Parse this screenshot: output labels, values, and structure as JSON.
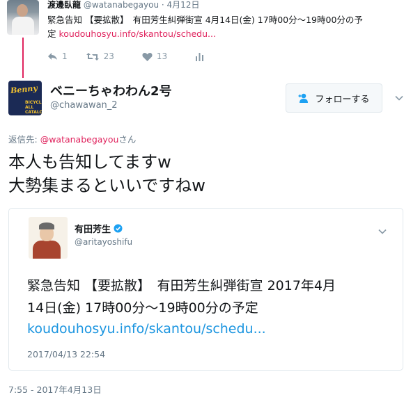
{
  "parent": {
    "name": "渡邊臥龍",
    "handle": "@watanabegayou",
    "dot": "·",
    "time": "4月12日",
    "text_line1": "緊急告知 【要拡散】　有田芳生糾弾街宣 4月14日(金) 17時00分〜19時00分の予",
    "text_line2": "定 ",
    "link": "koudouhosyu.info/skantou/schedu...",
    "actions": {
      "reply_count": "1",
      "retweet_count": "23",
      "like_count": "13"
    }
  },
  "tweet": {
    "display_name": "ベニーちゃわわん2号",
    "screen_name": "@chawawan_2",
    "follow_label": "フォローする",
    "avatar_logo": "Benny",
    "avatar_sub": "BICYCLE ALL CATALOG",
    "reply_prefix": "返信先: ",
    "reply_mention": "@watanabegayou",
    "reply_suffix": "さん",
    "text_line1": "本人も告知してますw",
    "text_line2": "大勢集まるといいですねw",
    "timestamp": "7:55 - 2017年4月13日"
  },
  "quote": {
    "name": "有田芳生",
    "handle": "@aritayoshifu",
    "text_line1": "緊急告知 【要拡散】　有田芳生糾弾街宣 2017年4月",
    "text_line2": "14日(金) 17時00分〜19時00分の予定",
    "link": "koudouhosyu.info/skantou/schedu...",
    "time": "2017/04/13 22:54"
  },
  "icons": [
    "reply-icon",
    "retweet-icon",
    "like-icon",
    "analytics-icon",
    "follow-user-icon",
    "chevron-down-icon",
    "verified-badge-icon"
  ],
  "colors": {
    "link_red": "#e0245e",
    "link_blue": "#1b95e0",
    "muted": "#657786",
    "thread_line": "#e0245e"
  }
}
